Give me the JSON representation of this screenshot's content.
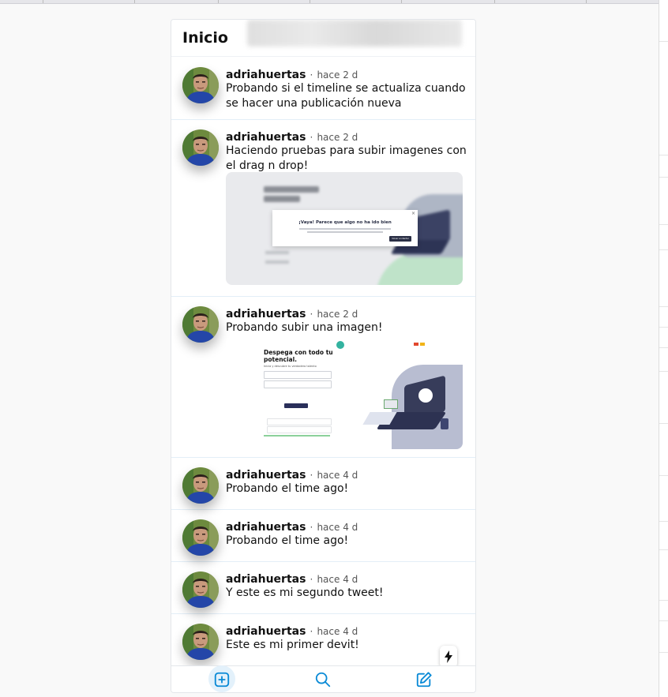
{
  "header": {
    "title": "Inicio"
  },
  "colors": {
    "accent": "#0a8ad6",
    "divider": "#e3eef7",
    "text": "#111111",
    "muted": "#555555"
  },
  "devits": [
    {
      "user": "adriahuertas",
      "separator": "·",
      "time": "hace 2 d",
      "text": "Probando si el timeline se actualiza cuando se hacer una publicación nueva"
    },
    {
      "user": "adriahuertas",
      "separator": "·",
      "time": "hace 2 d",
      "text": "Haciendo pruebas para subir imagenes con el drag n drop!",
      "image": {
        "dialog_title": "¡Vaya! Parece que algo no ha ido bien",
        "dialog_button": "Volver a intentar"
      }
    },
    {
      "user": "adriahuertas",
      "separator": "·",
      "time": "hace 2 d",
      "text": "Probando subir una imagen!",
      "image": {
        "headline": "Despega con todo tu potencial.",
        "subline": "Inicia y descubre tu verdadero talento"
      }
    },
    {
      "user": "adriahuertas",
      "separator": "·",
      "time": "hace 4 d",
      "text": "Probando el time ago!"
    },
    {
      "user": "adriahuertas",
      "separator": "·",
      "time": "hace 4 d",
      "text": "Probando el time ago!"
    },
    {
      "user": "adriahuertas",
      "separator": "·",
      "time": "hace 4 d",
      "text": "Y este es mi segundo tweet!"
    },
    {
      "user": "adriahuertas",
      "separator": "·",
      "time": "hace 4 d",
      "text": "Este es mi primer devit!"
    }
  ],
  "icons": {
    "fab": "lightning-icon",
    "nav": [
      "add-square-icon",
      "search-icon",
      "compose-icon"
    ]
  },
  "nav": {
    "active_index": 0
  }
}
